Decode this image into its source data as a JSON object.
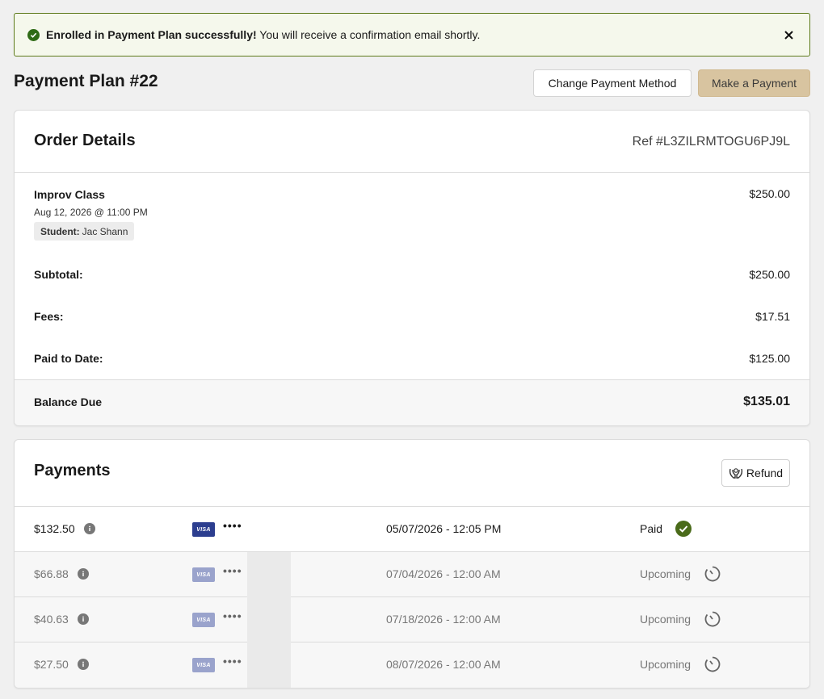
{
  "alert": {
    "bold": "Enrolled in Payment Plan successfully!",
    "text": " You will receive a confirmation email shortly."
  },
  "page": {
    "title": "Payment Plan #22",
    "change_method_label": "Change Payment Method",
    "make_payment_label": "Make a Payment"
  },
  "order": {
    "title": "Order Details",
    "ref": "Ref #L3ZILRMTOGU6PJ9L",
    "item": {
      "name": "Improv Class",
      "date": "Aug 12, 2026 @ 11:00 PM",
      "student_label": "Student:",
      "student_name": "Jac Shann",
      "price": "$250.00"
    },
    "subtotal_label": "Subtotal:",
    "subtotal": "$250.00",
    "fees_label": "Fees:",
    "fees": "$17.51",
    "paid_label": "Paid to Date:",
    "paid": "$125.00",
    "balance_label": "Balance Due",
    "balance": "$135.01"
  },
  "payments": {
    "title": "Payments",
    "refund_label": "Refund",
    "rows": [
      {
        "amount": "$132.50",
        "card": "VISA",
        "dots": "••••",
        "date": "05/07/2026 - 12:05 PM",
        "status": "Paid"
      },
      {
        "amount": "$66.88",
        "card": "VISA",
        "dots": "••••",
        "date": "07/04/2026 - 12:00 AM",
        "status": "Upcoming"
      },
      {
        "amount": "$40.63",
        "card": "VISA",
        "dots": "••••",
        "date": "07/18/2026 - 12:00 AM",
        "status": "Upcoming"
      },
      {
        "amount": "$27.50",
        "card": "VISA",
        "dots": "••••",
        "date": "08/07/2026 - 12:00 AM",
        "status": "Upcoming"
      }
    ]
  },
  "colors": {
    "success": "#2f6b16",
    "accent_button": "#d8c4a0"
  }
}
